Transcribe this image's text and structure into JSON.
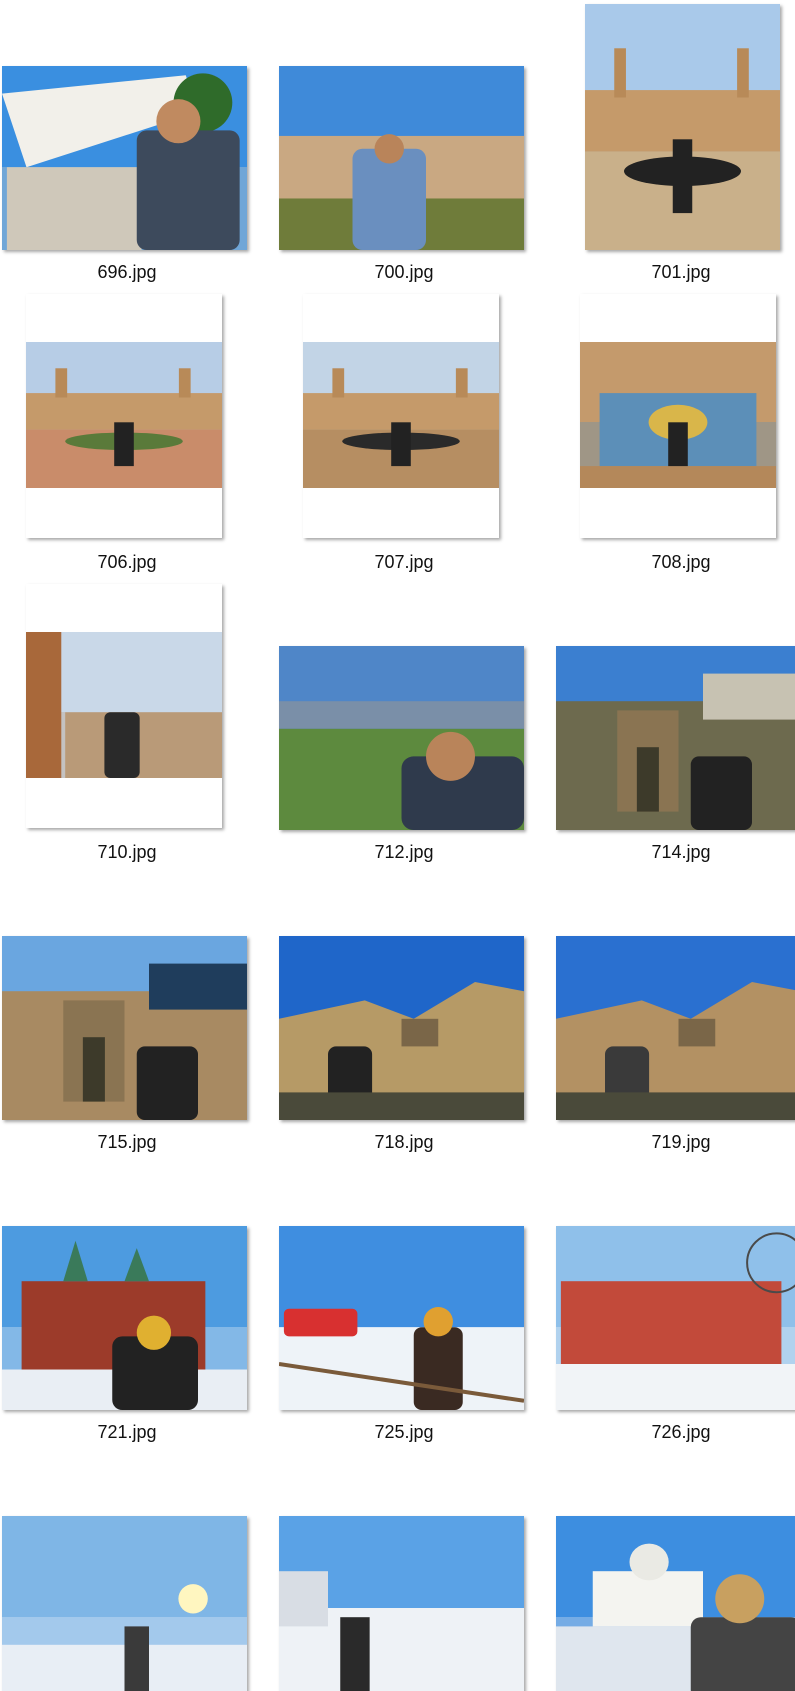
{
  "files": [
    {
      "name": "696.jpg",
      "orientation": "landscape",
      "scene": "canopy",
      "sky": "#3a8fe0",
      "ground": "#d8d2c6",
      "accent": "#3d4a5c"
    },
    {
      "name": "700.jpg",
      "orientation": "landscape",
      "scene": "city",
      "sky": "#3f8ad9",
      "ground": "#9a7a52",
      "accent": "#6a8fbf"
    },
    {
      "name": "701.jpg",
      "orientation": "portrait",
      "scene": "plaza",
      "sky": "#a9c9ea",
      "ground": "#c9b08a",
      "accent": "#222222"
    },
    {
      "name": "706.jpg",
      "orientation": "portrait-letterbox",
      "scene": "plaza",
      "sky": "#b7cde6",
      "ground": "#c98c6a",
      "accent": "#5a7a3a"
    },
    {
      "name": "707.jpg",
      "orientation": "portrait-letterbox",
      "scene": "plaza",
      "sky": "#c2d4e6",
      "ground": "#b68e62",
      "accent": "#2a2a2a"
    },
    {
      "name": "708.jpg",
      "orientation": "portrait-letterbox",
      "scene": "tiles",
      "sky": "#c49a6c",
      "ground": "#5c8fb8",
      "accent": "#d9b64a"
    },
    {
      "name": "710.jpg",
      "orientation": "portrait-letterbox",
      "scene": "column",
      "sky": "#c9d8e8",
      "ground": "#b99a78",
      "accent": "#2a2a2a"
    },
    {
      "name": "712.jpg",
      "orientation": "landscape",
      "scene": "valley",
      "sky": "#4f86c8",
      "ground": "#5d8a3e",
      "accent": "#2f3a4c"
    },
    {
      "name": "714.jpg",
      "orientation": "landscape",
      "scene": "bridge",
      "sky": "#3b7fd0",
      "ground": "#6d6a4e",
      "accent": "#c7c2b2"
    },
    {
      "name": "715.jpg",
      "orientation": "landscape",
      "scene": "bridge",
      "sky": "#6aa6e0",
      "ground": "#a88a62",
      "accent": "#1f3d5c"
    },
    {
      "name": "718.jpg",
      "orientation": "landscape",
      "scene": "cliff",
      "sky": "#1f66c9",
      "ground": "#b69a66",
      "accent": "#222222"
    },
    {
      "name": "719.jpg",
      "orientation": "landscape",
      "scene": "cliff",
      "sky": "#2a70d0",
      "ground": "#b39163",
      "accent": "#3a3a3a"
    },
    {
      "name": "721.jpg",
      "orientation": "landscape",
      "scene": "cathedral",
      "sky": "#4d9be0",
      "ground": "#e9eef4",
      "accent": "#9c3b2a"
    },
    {
      "name": "725.jpg",
      "orientation": "landscape",
      "scene": "harbor",
      "sky": "#3f8ee0",
      "ground": "#eef3f8",
      "accent": "#d83030"
    },
    {
      "name": "726.jpg",
      "orientation": "landscape",
      "scene": "redbuilding",
      "sky": "#8fc0ea",
      "ground": "#f1f4f7",
      "accent": "#c24a3a"
    },
    {
      "name": "",
      "orientation": "landscape-cut",
      "scene": "sunset",
      "sky": "#7fb6e6",
      "ground": "#e8eef5",
      "accent": "#3a3a3a"
    },
    {
      "name": "",
      "orientation": "landscape-cut",
      "scene": "icy",
      "sky": "#5aa2e6",
      "ground": "#eef2f6",
      "accent": "#2a2a2a"
    },
    {
      "name": "",
      "orientation": "landscape-cut",
      "scene": "whitechurch",
      "sky": "#3d8ee0",
      "ground": "#dfe6ee",
      "accent": "#444444"
    }
  ]
}
